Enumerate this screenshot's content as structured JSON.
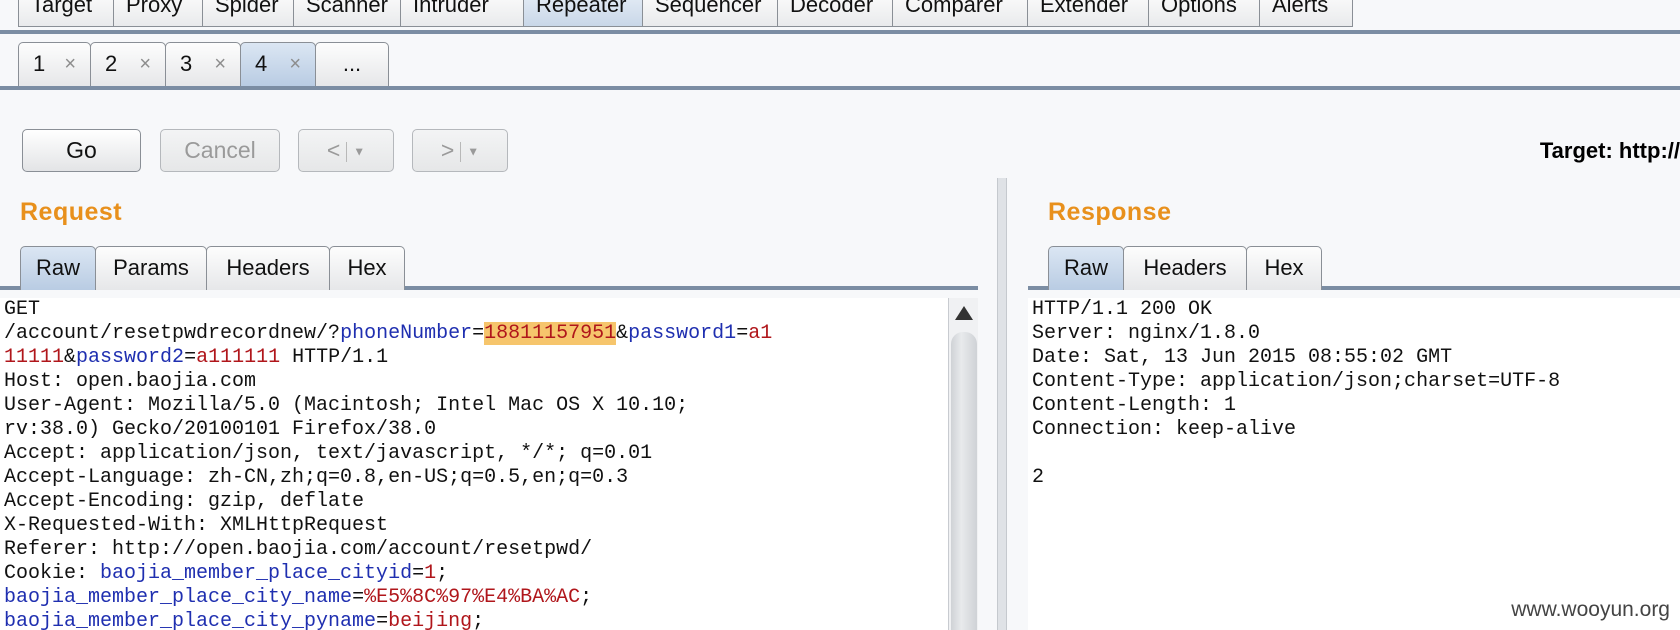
{
  "main_tabs": [
    {
      "label": "Target"
    },
    {
      "label": "Proxy"
    },
    {
      "label": "Spider"
    },
    {
      "label": "Scanner"
    },
    {
      "label": "Intruder"
    },
    {
      "label": "Repeater"
    },
    {
      "label": "Sequencer"
    },
    {
      "label": "Decoder"
    },
    {
      "label": "Comparer"
    },
    {
      "label": "Extender"
    },
    {
      "label": "Options"
    },
    {
      "label": "Alerts"
    }
  ],
  "active_main_tab": "Repeater",
  "sub_tabs": [
    {
      "label": "1"
    },
    {
      "label": "2"
    },
    {
      "label": "3"
    },
    {
      "label": "4"
    }
  ],
  "sub_tab_more": "...",
  "close_glyph": "×",
  "toolbar": {
    "go_label": "Go",
    "cancel_label": "Cancel",
    "back_label": "<",
    "forward_label": ">",
    "dropdown_glyph": "▼",
    "target_label": "Target: http://"
  },
  "request": {
    "title": "Request",
    "tabs": [
      {
        "label": "Raw"
      },
      {
        "label": "Params"
      },
      {
        "label": "Headers"
      },
      {
        "label": "Hex"
      }
    ],
    "lines": {
      "l1": "GET",
      "l2_path": "/account/resetpwdrecordnew/?",
      "l2_k1": "phoneNumber",
      "l2_eq1": "=",
      "l2_v1": "18811157951",
      "l2_amp1": "&",
      "l2_k2": "password1",
      "l2_eq2": "=",
      "l2_v2a": "a1",
      "l3_v2b": "11111",
      "l3_amp2": "&",
      "l3_k3": "password2",
      "l3_eq3": "=",
      "l3_v3": "a111111",
      "l3_proto": " HTTP/1.1",
      "l4": "Host: open.baojia.com",
      "l5": "User-Agent: Mozilla/5.0 (Macintosh; Intel Mac OS X 10.10;",
      "l6": "rv:38.0) Gecko/20100101 Firefox/38.0",
      "l7": "Accept: application/json, text/javascript, */*; q=0.01",
      "l8": "Accept-Language: zh-CN,zh;q=0.8,en-US;q=0.5,en;q=0.3",
      "l9": "Accept-Encoding: gzip, deflate",
      "l10": "X-Requested-With: XMLHttpRequest",
      "l11": "Referer: http://open.baojia.com/account/resetpwd/",
      "l12_prefix": "Cookie: ",
      "l12_k": "baojia_member_place_cityid",
      "l12_eq": "=",
      "l12_v": "1",
      "l12_semi": ";",
      "l13_k": "baojia_member_place_city_name",
      "l13_eq": "=",
      "l13_v": "%E5%8C%97%E4%BA%AC",
      "l13_semi": ";",
      "l14_k": "baojia_member_place_city_pyname",
      "l14_eq": "=",
      "l14_v": "beijing",
      "l14_semi": ";"
    }
  },
  "response": {
    "title": "Response",
    "tabs": [
      {
        "label": "Raw"
      },
      {
        "label": "Headers"
      },
      {
        "label": "Hex"
      }
    ],
    "lines": {
      "l1": "HTTP/1.1 200 OK",
      "l2": "Server: nginx/1.8.0",
      "l3": "Date: Sat, 13 Jun 2015 08:55:02 GMT",
      "l4": "Content-Type: application/json;charset=UTF-8",
      "l5": "Content-Length: 1",
      "l6": "Connection: keep-alive",
      "l7": "",
      "l8": "2"
    }
  },
  "watermark": "www.wooyun.org",
  "colors": {
    "accent_title": "#e8901c",
    "param_key": "#1f2fb0",
    "param_value": "#b0161b",
    "highlight": "#f6c56c"
  }
}
